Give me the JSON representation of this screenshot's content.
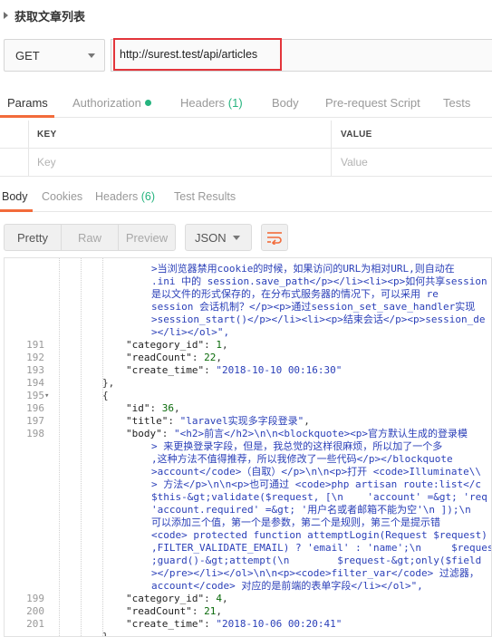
{
  "header": {
    "title": "获取文章列表"
  },
  "request": {
    "method": "GET",
    "url": "http://surest.test/api/articles"
  },
  "request_tabs": [
    {
      "label": "Params",
      "active": true
    },
    {
      "label": "Authorization",
      "dot": true
    },
    {
      "label": "Headers",
      "count": "(1)"
    },
    {
      "label": "Body"
    },
    {
      "label": "Pre-request Script"
    },
    {
      "label": "Tests"
    }
  ],
  "params_table": {
    "key_header": "KEY",
    "value_header": "VALUE",
    "key_placeholder": "Key",
    "value_placeholder": "Value"
  },
  "response_tabs": [
    {
      "label": "Body",
      "active": true
    },
    {
      "label": "Cookies"
    },
    {
      "label": "Headers",
      "count": "(6)"
    },
    {
      "label": "Test Results"
    }
  ],
  "view_modes": [
    "Pretty",
    "Raw",
    "Preview"
  ],
  "format": "JSON",
  "colors": {
    "accent": "#f26b3a",
    "url_highlight": "#e3353b",
    "green": "#26b47f"
  },
  "code_lines": [
    {
      "n": "",
      "indent": 4,
      "text": ">当浏览器禁用cookie的时候，如果访问的URL为相对URL,则自动在",
      "cls": "s"
    },
    {
      "n": "",
      "indent": 4,
      "text": ".ini 中的 session.save_path</p></li><li><p>如何共享session",
      "cls": "s"
    },
    {
      "n": "",
      "indent": 4,
      "text": "是以文件的形式保存的，在分布式服务器的情况下，可以采用 re",
      "cls": "s"
    },
    {
      "n": "",
      "indent": 4,
      "text": "session 会话机制？</p><p>通过session_set_save_handler实现",
      "cls": "s"
    },
    {
      "n": "",
      "indent": 4,
      "text": ">session_start()</p></li><li><p>结束会话</p><p>session_de",
      "cls": "s"
    },
    {
      "n": "",
      "indent": 4,
      "text": "></li></ol>\",",
      "cls": "s"
    },
    {
      "n": "191",
      "indent": 3,
      "key": "\"category_id\"",
      "val": "1",
      "vcls": "n",
      "tail": ","
    },
    {
      "n": "192",
      "indent": 3,
      "key": "\"readCount\"",
      "val": "22",
      "vcls": "n",
      "tail": ","
    },
    {
      "n": "193",
      "indent": 3,
      "key": "\"create_time\"",
      "val": "\"2018-10-10 00:16:30\"",
      "vcls": "s",
      "tail": ""
    },
    {
      "n": "194",
      "indent": 2,
      "text": "},",
      "cls": "p"
    },
    {
      "n": "195",
      "indent": 2,
      "text": "{",
      "cls": "p",
      "fold": true
    },
    {
      "n": "196",
      "indent": 3,
      "key": "\"id\"",
      "val": "36",
      "vcls": "n",
      "tail": ","
    },
    {
      "n": "197",
      "indent": 3,
      "key": "\"title\"",
      "val": "\"laravel实现多字段登录\"",
      "vcls": "s",
      "tail": ","
    },
    {
      "n": "198",
      "indent": 3,
      "key": "\"body\"",
      "val": "\"<h2>前言</h2>\\n\\n<blockquote><p>官方默认生成的登录模",
      "vcls": "s",
      "tail": ""
    },
    {
      "n": "",
      "indent": 4,
      "text": "> 来更换登录字段，但是，我总觉的这样很麻烦，所以加了一个多",
      "cls": "s"
    },
    {
      "n": "",
      "indent": 4,
      "text": ",这种方法不值得推荐，所以我修改了一些代码</p></blockquote",
      "cls": "s"
    },
    {
      "n": "",
      "indent": 4,
      "text": ">account</code>（自取）</p>\\n\\n<p>打开 <code>Illuminate\\\\",
      "cls": "s"
    },
    {
      "n": "",
      "indent": 4,
      "text": "> 方法</p>\\n\\n<p>也可通过 <code>php artisan route:list</c",
      "cls": "s"
    },
    {
      "n": "",
      "indent": 4,
      "text": "$this-&gt;validate($request, [\\n    'account' =&gt; 'req",
      "cls": "s"
    },
    {
      "n": "",
      "indent": 4,
      "text": "'account.required' =&gt; '用户名或者邮箱不能为空'\\n ]);\\n",
      "cls": "s"
    },
    {
      "n": "",
      "indent": 4,
      "text": "可以添加三个值，第一个是参数，第二个是规则，第三个是提示错",
      "cls": "s"
    },
    {
      "n": "",
      "indent": 4,
      "text": "<code> protected function attemptLogin(Request $request)",
      "cls": "s"
    },
    {
      "n": "",
      "indent": 4,
      "text": ",FILTER_VALIDATE_EMAIL) ? 'email' : 'name';\\n     $reques",
      "cls": "s"
    },
    {
      "n": "",
      "indent": 4,
      "text": ";guard()-&gt;attempt(\\n        $request-&gt;only($field",
      "cls": "s"
    },
    {
      "n": "",
      "indent": 4,
      "text": "></pre></li></ol>\\n\\n<p><code>filter_var</code> 过滤器，",
      "cls": "s"
    },
    {
      "n": "",
      "indent": 4,
      "text": "account</code> 对应的是前端的表单字段</li></ol>\",",
      "cls": "s"
    },
    {
      "n": "199",
      "indent": 3,
      "key": "\"category_id\"",
      "val": "4",
      "vcls": "n",
      "tail": ","
    },
    {
      "n": "200",
      "indent": 3,
      "key": "\"readCount\"",
      "val": "21",
      "vcls": "n",
      "tail": ","
    },
    {
      "n": "201",
      "indent": 3,
      "key": "\"create_time\"",
      "val": "\"2018-10-06 00:20:41\"",
      "vcls": "s",
      "tail": ""
    },
    {
      "n": "",
      "indent": 2,
      "text": "},",
      "cls": "p"
    }
  ]
}
